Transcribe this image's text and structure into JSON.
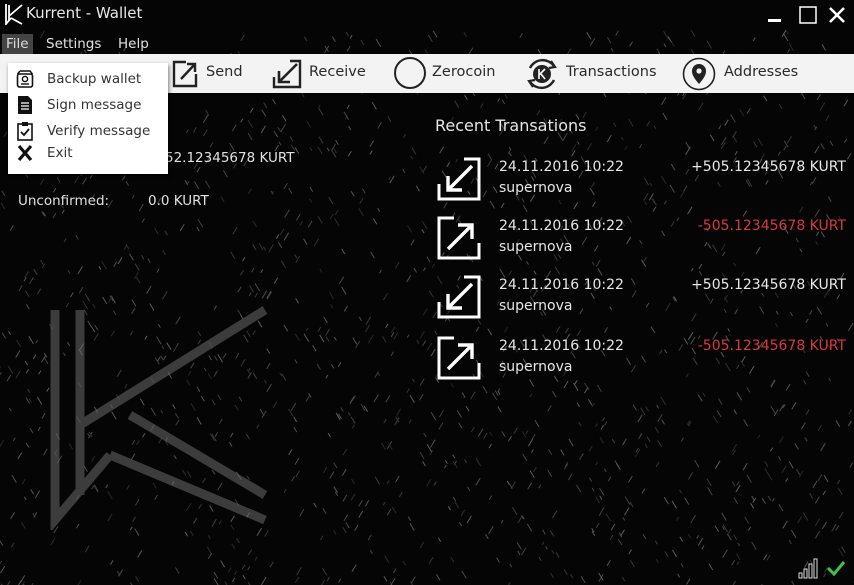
{
  "window": {
    "title": "Kurrent - Wallet"
  },
  "icons": {
    "app_logo": "kurrent-k-logo",
    "minimize": "minimize-icon",
    "maximize": "maximize-icon",
    "close": "close-icon",
    "send": "arrow-up-right-box-icon",
    "receive": "arrow-down-left-box-icon",
    "zerocoin": "circle-icon",
    "transactions": "k-coin-cycle-icon",
    "addresses": "map-pin-icon",
    "backup": "hard-drive-icon",
    "sign": "document-icon",
    "verify": "clipboard-check-icon",
    "exit": "x-icon",
    "signal": "signal-bars-icon",
    "sync": "check-icon"
  },
  "menu": {
    "file": "File",
    "settings": "Settings",
    "help": "Help"
  },
  "file_menu": {
    "items": [
      {
        "label": "Backup wallet"
      },
      {
        "label": "Sign message"
      },
      {
        "label": "Verify message"
      },
      {
        "label": "Exit"
      }
    ]
  },
  "toolbar": {
    "send": "Send",
    "receive": "Receive",
    "zerocoin": "Zerocoin",
    "transactions": "Transactions",
    "addresses": "Addresses"
  },
  "balances": {
    "available_value": "52.12345678 KURT",
    "unconfirmed_label": "Unconfirmed:",
    "unconfirmed_value": "0.0 KURT"
  },
  "recent": {
    "title": "Recent Transations",
    "transactions": [
      {
        "date": "24.11.2016 10:22",
        "label": "supernova",
        "amount": "+505.12345678 KURT",
        "direction": "in"
      },
      {
        "date": "24.11.2016 10:22",
        "label": "supernova",
        "amount": "-505.12345678 KURT",
        "direction": "out"
      },
      {
        "date": "24.11.2016 10:22",
        "label": "supernova",
        "amount": "+505.12345678 KURT",
        "direction": "in"
      },
      {
        "date": "24.11.2016 10:22",
        "label": "supernova",
        "amount": "-505.12345678 KURT",
        "direction": "out"
      }
    ]
  },
  "colors": {
    "background": "#050505",
    "toolbar": "#f3f3f3",
    "outgoing": "#d63a3a",
    "sync_ok": "#3ec24a"
  }
}
